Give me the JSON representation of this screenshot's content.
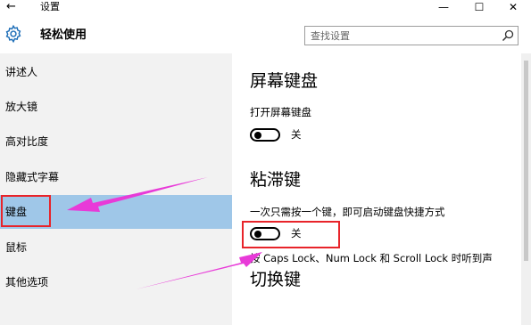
{
  "window": {
    "back_icon": "back-arrow-icon",
    "title": "设置",
    "minimize_glyph": "—",
    "maximize_glyph": "☐",
    "close_glyph": "✕"
  },
  "header": {
    "gear_icon": "gear-icon",
    "title": "轻松使用",
    "search_placeholder": "查找设置",
    "search_icon": "search-icon"
  },
  "sidebar": {
    "selected_index": 4,
    "items": [
      {
        "label": "讲述人"
      },
      {
        "label": "放大镜"
      },
      {
        "label": "高对比度"
      },
      {
        "label": "隐藏式字幕"
      },
      {
        "label": "键盘"
      },
      {
        "label": "鼠标"
      },
      {
        "label": "其他选项"
      }
    ]
  },
  "main": {
    "sections": [
      {
        "title": "屏幕键盘",
        "option_label": "打开屏幕键盘",
        "toggle_state": "关",
        "toggle_on": false
      },
      {
        "title": "粘滞键",
        "option_label": "一次只需按一个键，即可启动键盘快捷方式",
        "toggle_state": "关",
        "toggle_on": false
      },
      {
        "title": "切换键",
        "description": "按 Caps Lock、Num Lock 和 Scroll Lock 时听到声"
      }
    ]
  },
  "annotations": {
    "highlight_color": "#e8242a",
    "arrow_color": "#e83ad8"
  },
  "colors": {
    "sidebar_bg": "#f2f2f2",
    "selected_bg": "#9fc7e8"
  }
}
